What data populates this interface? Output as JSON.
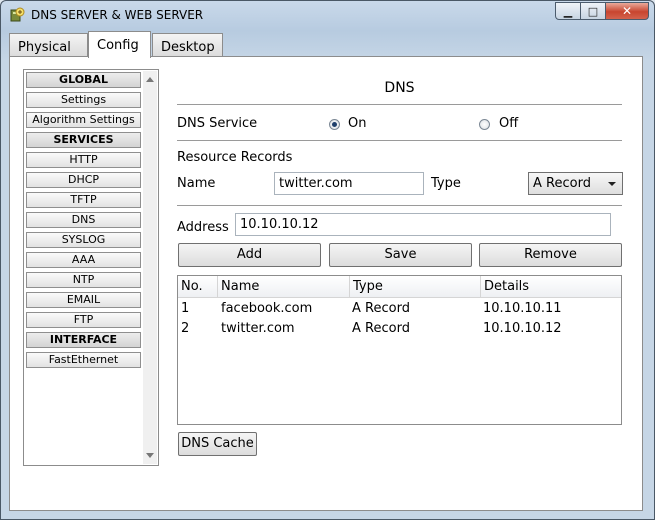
{
  "window": {
    "title": "DNS SERVER & WEB SERVER",
    "minimize_glyph": "▁",
    "maximize_glyph": "□",
    "close_glyph": "✕"
  },
  "tabs": [
    {
      "label": "Physical"
    },
    {
      "label": "Config"
    },
    {
      "label": "Desktop"
    }
  ],
  "sidebar": {
    "items": [
      {
        "label": "GLOBAL",
        "header": true
      },
      {
        "label": "Settings"
      },
      {
        "label": "Algorithm Settings"
      },
      {
        "label": "SERVICES",
        "header": true
      },
      {
        "label": "HTTP"
      },
      {
        "label": "DHCP"
      },
      {
        "label": "TFTP"
      },
      {
        "label": "DNS"
      },
      {
        "label": "SYSLOG"
      },
      {
        "label": "AAA"
      },
      {
        "label": "NTP"
      },
      {
        "label": "EMAIL"
      },
      {
        "label": "FTP"
      },
      {
        "label": "INTERFACE",
        "header": true
      },
      {
        "label": "FastEthernet"
      }
    ]
  },
  "dns": {
    "title": "DNS",
    "service_label": "DNS Service",
    "on_label": "On",
    "off_label": "Off",
    "service_state": "on",
    "resource_records_label": "Resource Records",
    "name_label": "Name",
    "name_value": "twitter.com",
    "type_label": "Type",
    "type_value": "A Record",
    "address_label": "Address",
    "address_value": "10.10.10.12",
    "add_label": "Add",
    "save_label": "Save",
    "remove_label": "Remove",
    "cache_label": "DNS Cache"
  },
  "records_table": {
    "headers": [
      "No.",
      "Name",
      "Type",
      "Details"
    ],
    "rows": [
      [
        "1",
        "facebook.com",
        "A Record",
        "10.10.10.11"
      ],
      [
        "2",
        "twitter.com",
        "A Record",
        "10.10.10.12"
      ]
    ]
  },
  "colors": {
    "title_bar": "#c9d9ea",
    "close_button": "#c8452f",
    "radio_dot": "#1f3f6b"
  }
}
